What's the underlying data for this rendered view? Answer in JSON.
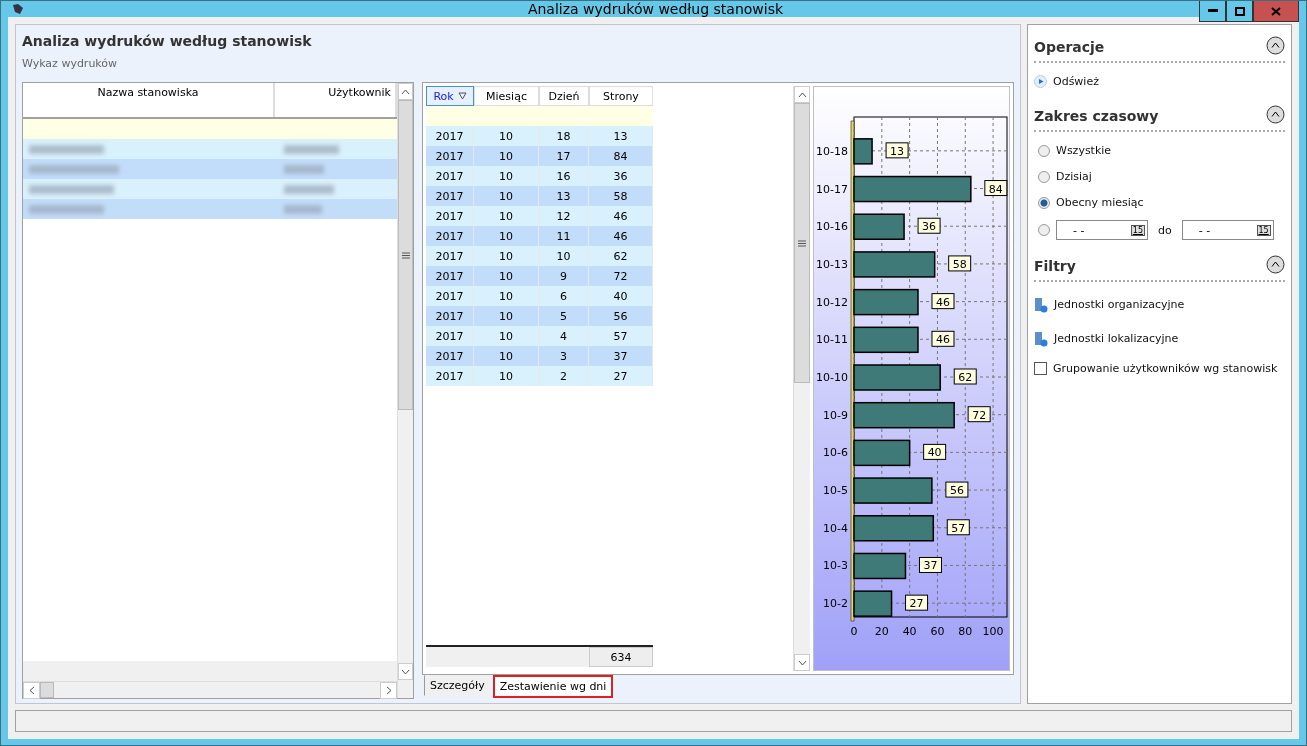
{
  "window": {
    "title": "Analiza wydruków według stanowisk"
  },
  "header": {
    "title": "Analiza wydruków według stanowisk",
    "subtitle": "Wykaz wydruków"
  },
  "stations_table": {
    "columns": [
      "Nazwa stanowiska",
      "Użytkownik"
    ]
  },
  "details_table": {
    "columns": [
      {
        "label": "Rok",
        "sorted": true
      },
      {
        "label": "Miesiąc",
        "sorted": false
      },
      {
        "label": "Dzień",
        "sorted": false
      },
      {
        "label": "Strony",
        "sorted": false
      }
    ],
    "rows": [
      [
        "2017",
        "10",
        "18",
        "13"
      ],
      [
        "2017",
        "10",
        "17",
        "84"
      ],
      [
        "2017",
        "10",
        "16",
        "36"
      ],
      [
        "2017",
        "10",
        "13",
        "58"
      ],
      [
        "2017",
        "10",
        "12",
        "46"
      ],
      [
        "2017",
        "10",
        "11",
        "46"
      ],
      [
        "2017",
        "10",
        "10",
        "62"
      ],
      [
        "2017",
        "10",
        "9",
        "72"
      ],
      [
        "2017",
        "10",
        "6",
        "40"
      ],
      [
        "2017",
        "10",
        "5",
        "56"
      ],
      [
        "2017",
        "10",
        "4",
        "57"
      ],
      [
        "2017",
        "10",
        "3",
        "37"
      ],
      [
        "2017",
        "10",
        "2",
        "27"
      ]
    ],
    "total": "634"
  },
  "chart_data": {
    "type": "bar",
    "orientation": "horizontal",
    "categories": [
      "10-18",
      "10-17",
      "10-16",
      "10-13",
      "10-12",
      "10-11",
      "10-10",
      "10-9",
      "10-6",
      "10-5",
      "10-4",
      "10-3",
      "10-2"
    ],
    "series": [
      {
        "color": "#3f7a78",
        "values": [
          13,
          84,
          36,
          58,
          46,
          46,
          62,
          72,
          40,
          56,
          57,
          37,
          27
        ]
      }
    ],
    "xlim": [
      0,
      110
    ],
    "xticks": [
      0,
      20,
      40,
      60,
      80,
      100
    ],
    "data_labels": true,
    "grid": true
  },
  "tabs": [
    {
      "label": "Szczegóły",
      "selected": false
    },
    {
      "label": "Zestawienie wg dni",
      "selected": true
    }
  ],
  "sidebar": {
    "sections": [
      {
        "title": "Operacje",
        "expanded": true,
        "items": [
          {
            "kind": "action",
            "label": "Odśwież"
          }
        ]
      },
      {
        "title": "Zakres czasowy",
        "expanded": true,
        "items": [
          {
            "kind": "radio",
            "label": "Wszystkie",
            "selected": false
          },
          {
            "kind": "radio",
            "label": "Dzisiaj",
            "selected": false
          },
          {
            "kind": "radio",
            "label": "Obecny miesiąc",
            "selected": true
          },
          {
            "kind": "range",
            "selected": false,
            "from": "- -",
            "from_calendar": "15",
            "separator": "do",
            "to": "- -",
            "to_calendar": "15"
          }
        ]
      },
      {
        "title": "Filtry",
        "expanded": true,
        "items": [
          {
            "kind": "filter",
            "label": "Jednostki organizacyjne"
          },
          {
            "kind": "filter",
            "label": "Jednostki lokalizacyjne"
          },
          {
            "kind": "checkbox",
            "label": "Grupowanie użytkowników wg stanowisk",
            "checked": false
          }
        ]
      }
    ]
  }
}
